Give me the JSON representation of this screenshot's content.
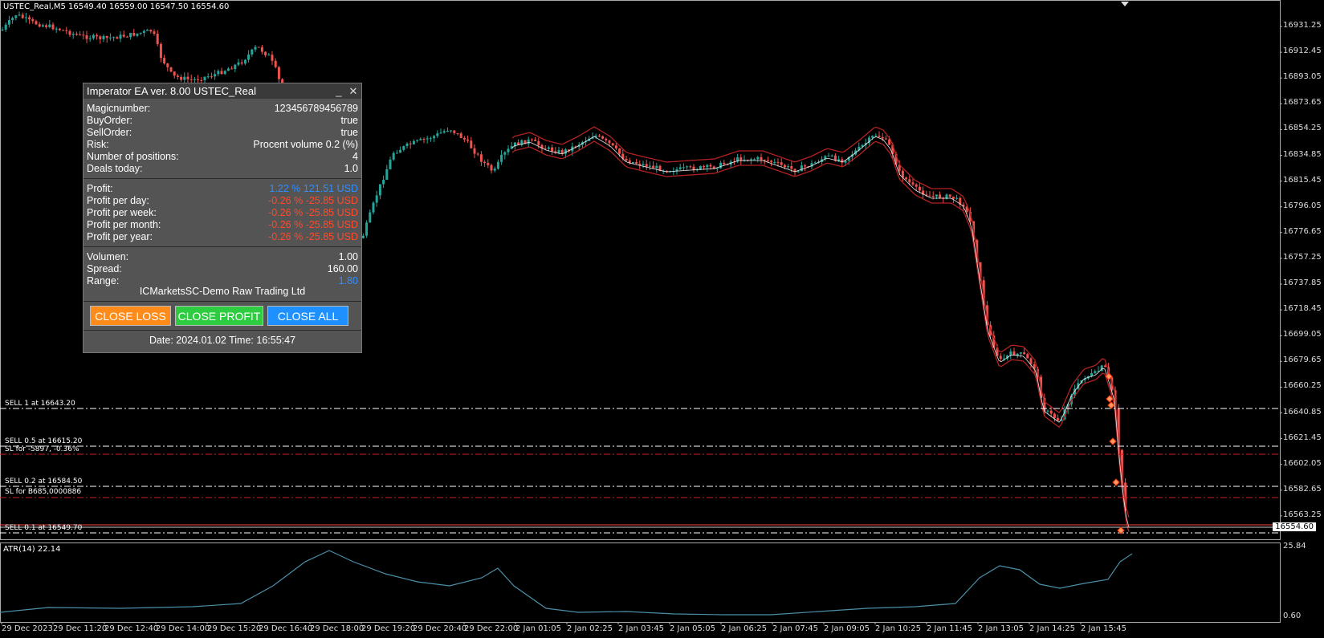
{
  "chart": {
    "header": "USTEC_Real,M5   16549.40  16559.00  16547.50  16554.60",
    "price_axis": [
      "16931.25",
      "16912.45",
      "16893.05",
      "16873.65",
      "16854.25",
      "16834.85",
      "16815.45",
      "16796.05",
      "16776.65",
      "16757.25",
      "16737.85",
      "16718.45",
      "16699.05",
      "16679.65",
      "16660.25",
      "16640.85",
      "16621.45",
      "16602.05",
      "16582.65",
      "16563.25"
    ],
    "current_price": "16554.60",
    "time_axis": [
      "29 Dec 2023",
      "29 Dec 11:20",
      "29 Dec 12:40",
      "29 Dec 14:00",
      "29 Dec 15:20",
      "29 Dec 16:40",
      "29 Dec 18:00",
      "29 Dec 19:20",
      "29 Dec 20:40",
      "29 Dec 22:00",
      "2 Jan 01:05",
      "2 Jan 02:25",
      "2 Jan 03:45",
      "2 Jan 05:05",
      "2 Jan 06:25",
      "2 Jan 07:45",
      "2 Jan 09:05",
      "2 Jan 10:25",
      "2 Jan 11:45",
      "2 Jan 13:05",
      "2 Jan 14:25",
      "2 Jan 15:45"
    ],
    "atr_label": "ATR(14) 22.14",
    "atr_axis": [
      "25.84",
      "0.60"
    ],
    "lines": [
      {
        "label": "SELL 1 at 16643.20"
      },
      {
        "label": "SELL 0.5 at 16615.20"
      },
      {
        "label": "SL for -5897, -0.36%"
      },
      {
        "label": "SELL 0.2 at 16584.50"
      },
      {
        "label": "SL for B685,0000886"
      },
      {
        "label": "SELL 0.1 at 16549.70"
      }
    ],
    "colors": {
      "bull": "#26a69a",
      "bear": "#ef5350",
      "band": "#b22222",
      "atr": "#4a8fa8",
      "grid_line": "#ffffff",
      "sl_line": "#cc2222"
    }
  },
  "panel": {
    "title": "Imperator EA ver. 8.00 USTEC_Real",
    "minimize_icon": "_",
    "close_icon": "✕",
    "info": [
      {
        "label": "Magicnumber:",
        "value": "123456789456789"
      },
      {
        "label": "BuyOrder:",
        "value": "true"
      },
      {
        "label": "SellOrder:",
        "value": "true"
      },
      {
        "label": "Risk:",
        "value": "Procent volume 0.2 (%)"
      },
      {
        "label": "Number of positions:",
        "value": "4"
      },
      {
        "label": "Deals today:",
        "value": "1.0"
      }
    ],
    "profit": [
      {
        "label": "Profit:",
        "value": "1.22 % 121.51 USD"
      },
      {
        "label": "Profit per day:",
        "value": "-0.26 % -25.85 USD"
      },
      {
        "label": "Profit per week:",
        "value": "-0.26 % -25.85 USD"
      },
      {
        "label": "Profit per month:",
        "value": "-0.26 % -25.85 USD"
      },
      {
        "label": "Profit per year:",
        "value": "-0.26 % -25.85 USD"
      }
    ],
    "market": [
      {
        "label": "Volumen:",
        "value": "1.00"
      },
      {
        "label": "Spread:",
        "value": "160.00"
      },
      {
        "label": "Range:",
        "value": "1.80"
      }
    ],
    "broker": "ICMarketsSC-Demo Raw Trading Ltd",
    "buttons": {
      "close_loss": "CLOSE LOSS",
      "close_profit": "CLOSE PROFIT",
      "close_all": "CLOSE ALL"
    },
    "button_colors": {
      "close_loss": "#ff8c1a",
      "close_profit": "#2ecc40",
      "close_all": "#1e90ff"
    },
    "footer": "Date: 2024.01.02 Time: 16:55:47"
  }
}
